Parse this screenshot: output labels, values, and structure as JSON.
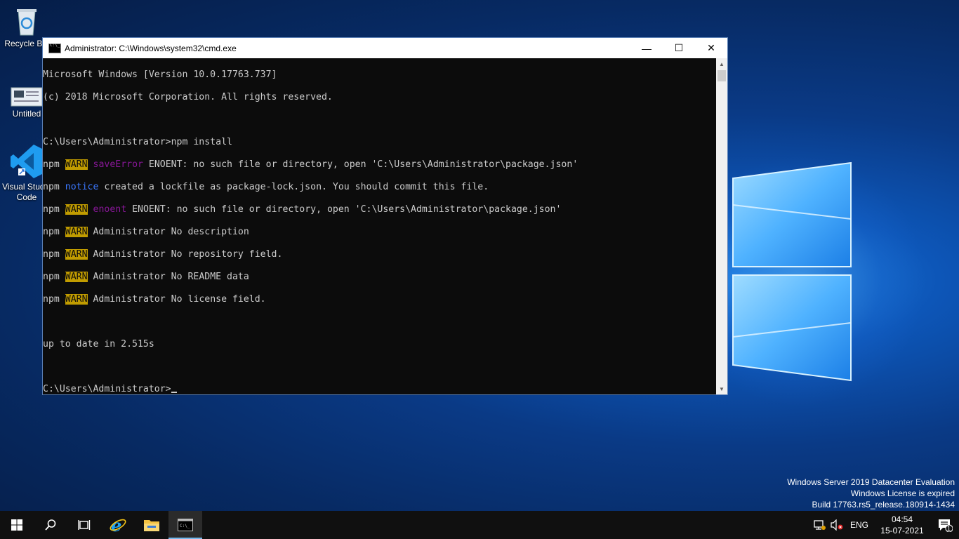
{
  "desktop": {
    "icons": [
      {
        "label": "Recycle Bin"
      },
      {
        "label": "Untitled"
      },
      {
        "label": "Visual Studio Code"
      }
    ]
  },
  "window": {
    "title": "Administrator: C:\\Windows\\system32\\cmd.exe",
    "minimize": "—",
    "maximize": "☐",
    "close": "✕"
  },
  "console": {
    "header1": "Microsoft Windows [Version 10.0.17763.737]",
    "header2": "(c) 2018 Microsoft Corporation. All rights reserved.",
    "prompt1": "C:\\Users\\Administrator>npm install",
    "npm": "npm",
    "warn": "WARN",
    "notice": "notice",
    "l1_tag": "saveError",
    "l1_text": " ENOENT: no such file or directory, open 'C:\\Users\\Administrator\\package.json'",
    "l2_text": " created a lockfile as package-lock.json. You should commit this file.",
    "l3_tag": "enoent",
    "l3_text": " ENOENT: no such file or directory, open 'C:\\Users\\Administrator\\package.json'",
    "l4_text": " Administrator No description",
    "l5_text": " Administrator No repository field.",
    "l6_text": " Administrator No README data",
    "l7_text": " Administrator No license field.",
    "result": "up to date in 2.515s",
    "prompt2": "C:\\Users\\Administrator>"
  },
  "watermark": {
    "line1": "Windows Server 2019 Datacenter Evaluation",
    "line2": "Windows License is expired",
    "line3": "Build 17763.rs5_release.180914-1434"
  },
  "taskbar": {
    "lang": "ENG",
    "time": "04:54",
    "date": "15-07-2021",
    "notification_count": "1"
  }
}
